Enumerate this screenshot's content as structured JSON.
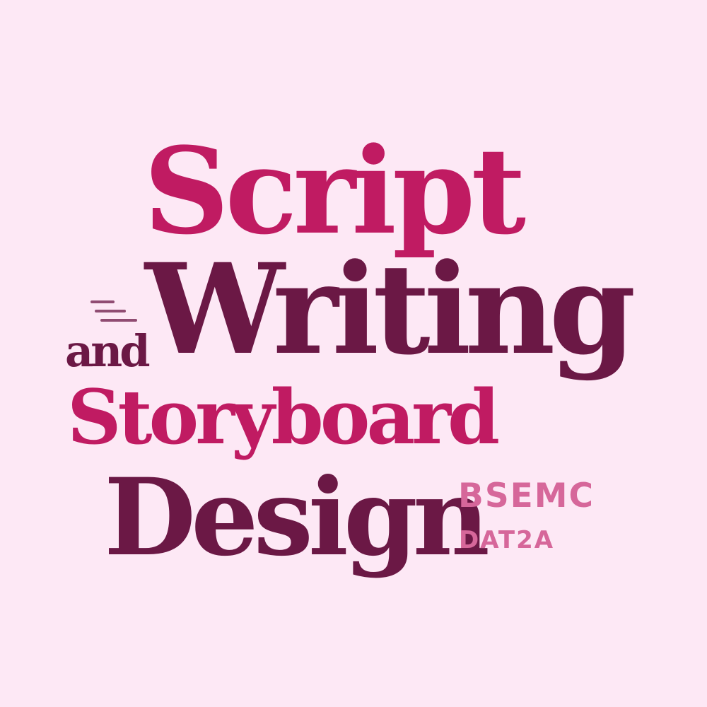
{
  "colors": {
    "background": "#fde8f5",
    "primary": "#c01b62",
    "dark": "#6b1845",
    "light": "#d6679a"
  },
  "title": {
    "line1": "Script",
    "connector": "and",
    "line2": "Writing",
    "line3": "Storyboard",
    "line4": "Design"
  },
  "course": {
    "code": "BSEMC",
    "section": "DAT2A"
  }
}
